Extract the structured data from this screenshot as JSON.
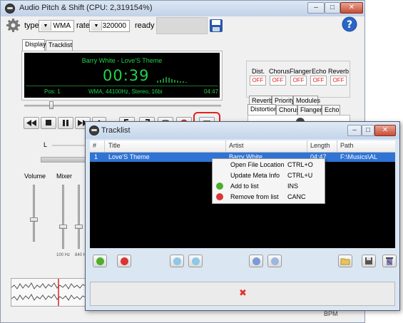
{
  "main_window": {
    "title": "Audio Pitch & Shift (CPU: 2,319154%)",
    "type_label": "type",
    "type_value": "WMA",
    "rate_label": "rate",
    "rate_value": "320000",
    "status": "ready",
    "help_symbol": "?"
  },
  "display_tabs": [
    "Display",
    "Tracklist"
  ],
  "display": {
    "track": "Barry White - Love'S Theme",
    "time": "00:39",
    "pos": "Pos: 1",
    "format": "WMA, 44100Hz, Stereo, 16bi",
    "duration": "04:47"
  },
  "effects": {
    "labels": [
      "Dist.",
      "Chorus",
      "Flanger",
      "Echo",
      "Reverb"
    ],
    "states": [
      "OFF",
      "OFF",
      "OFF",
      "OFF",
      "OFF"
    ],
    "tabs_row1": [
      "Reverb",
      "Priority",
      "Modules"
    ],
    "tabs_row2": [
      "Distortion",
      "Chorus",
      "Flanger",
      "Echo"
    ]
  },
  "left_panel": {
    "l_label": "L",
    "volume_label": "Volume",
    "mixer_label": "Mixer",
    "freq_labels": [
      "100 Hz",
      "840 H"
    ]
  },
  "bpm_label": "BPM",
  "tracklist_window": {
    "title": "Tracklist",
    "columns": [
      "#",
      "Title",
      "Artist",
      "Length",
      "Path"
    ],
    "rows": [
      {
        "num": "1",
        "title": "Love'S Theme",
        "artist": "Barry White",
        "length": "04:47",
        "path": "F:\\Musics\\AL"
      }
    ],
    "close_symbol": "✖"
  },
  "context_menu": [
    {
      "label": "Open File Location",
      "shortcut": "CTRL+O",
      "icon": ""
    },
    {
      "label": "Update Meta Info",
      "shortcut": "CTRL+U",
      "icon": ""
    },
    {
      "label": "Add to list",
      "shortcut": "INS",
      "icon": "add-icon"
    },
    {
      "label": "Remove from list",
      "shortcut": "CANC",
      "icon": "remove-icon"
    }
  ],
  "colors": {
    "accent_blue": "#2f74d5",
    "lcd_green": "#21d24a",
    "off_red": "#dd2222",
    "highlight_red": "#e02020"
  }
}
